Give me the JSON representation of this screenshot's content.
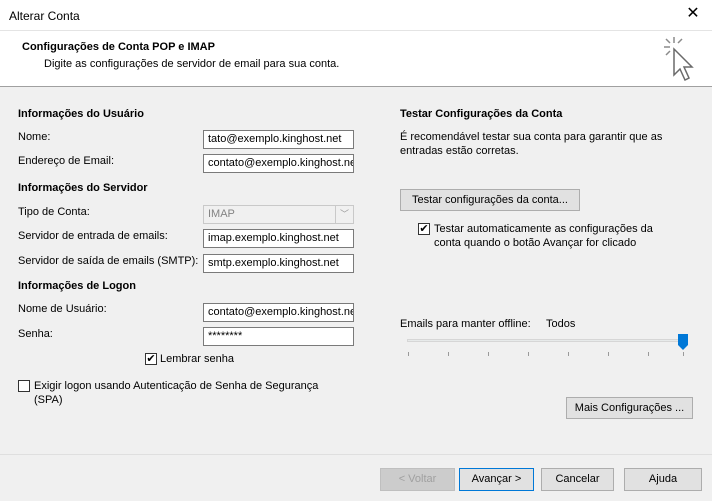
{
  "window": {
    "title": "Alterar Conta",
    "close_glyph": "✕"
  },
  "header": {
    "title": "Configurações de Conta POP e IMAP",
    "subtitle": "Digite as configurações de servidor de email para sua conta.",
    "icon": "cursor-click-icon"
  },
  "user_info": {
    "section": "Informações do Usuário",
    "name_label": "Nome:",
    "name_value": "tato@exemplo.kinghost.net",
    "email_label": "Endereço de Email:",
    "email_value": "contato@exemplo.kinghost.net"
  },
  "server_info": {
    "section": "Informações do Servidor",
    "account_type_label": "Tipo de Conta:",
    "account_type_value": "IMAP",
    "incoming_label": "Servidor de entrada de emails:",
    "incoming_value": "imap.exemplo.kinghost.net",
    "outgoing_label": "Servidor de saída de emails (SMTP):",
    "outgoing_value": "smtp.exemplo.kinghost.net"
  },
  "logon_info": {
    "section": "Informações de Logon",
    "username_label": "Nome de Usuário:",
    "username_value": "contato@exemplo.kinghost.net",
    "password_label": "Senha:",
    "password_value": "********",
    "remember_label": "Lembrar senha",
    "remember_checked": true,
    "spa_label": "Exigir logon usando Autenticação de Senha de Segurança",
    "spa_label_2": "(SPA)",
    "spa_checked": false
  },
  "test_settings": {
    "section": "Testar Configurações da Conta",
    "description_1": "É recomendável testar sua conta para garantir que as",
    "description_2": "entradas estão corretas.",
    "test_button": "Testar configurações da conta...",
    "auto_test_label_1": "Testar automaticamente as configurações da",
    "auto_test_label_2": "conta quando o botão Avançar for clicado",
    "auto_test_checked": true
  },
  "offline": {
    "label": "Emails para manter offline:",
    "value": "Todos",
    "slider_level": 1.0
  },
  "more_settings_button": "Mais Configurações ...",
  "footer": {
    "back": "< Voltar",
    "next": "Avançar >",
    "cancel": "Cancelar",
    "help": "Ajuda"
  }
}
